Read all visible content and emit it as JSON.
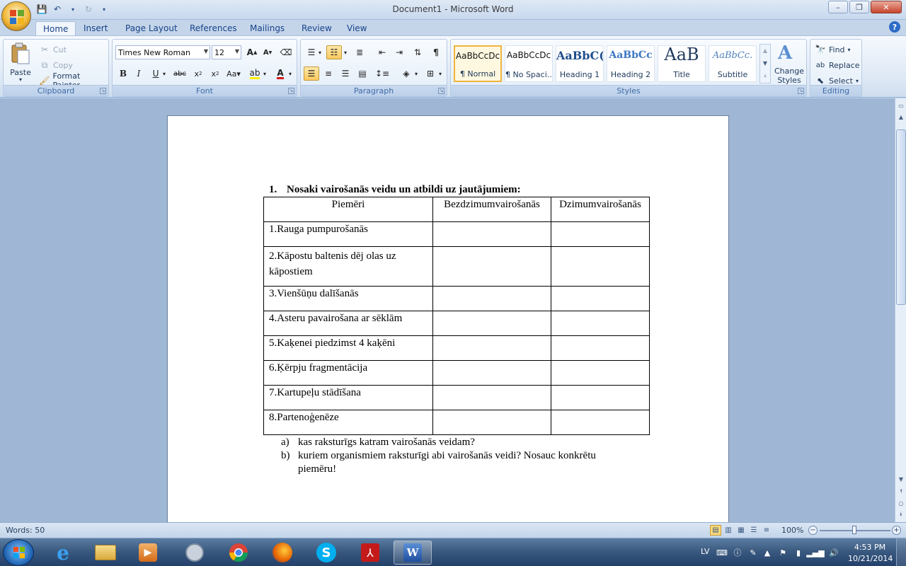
{
  "app": {
    "title": "Document1 - Microsoft Word"
  },
  "tabs": [
    "Home",
    "Insert",
    "Page Layout",
    "References",
    "Mailings",
    "Review",
    "View"
  ],
  "clipboard": {
    "paste": "Paste",
    "cut": "Cut",
    "copy": "Copy",
    "format_painter": "Format Painter",
    "label": "Clipboard"
  },
  "font": {
    "family": "Times New Roman",
    "size": "12",
    "label": "Font"
  },
  "paragraph": {
    "label": "Paragraph"
  },
  "styles": {
    "items": [
      {
        "sample": "AaBbCcDc",
        "name": "¶ Normal"
      },
      {
        "sample": "AaBbCcDc",
        "name": "¶ No Spaci..."
      },
      {
        "sample": "AaBbC(",
        "name": "Heading 1"
      },
      {
        "sample": "AaBbCc",
        "name": "Heading 2"
      },
      {
        "sample": "AaB",
        "name": "Title"
      },
      {
        "sample": "AaBbCc.",
        "name": "Subtitle"
      }
    ],
    "change_styles": "Change Styles",
    "label": "Styles"
  },
  "editing": {
    "find": "Find",
    "replace": "Replace",
    "select": "Select",
    "label": "Editing"
  },
  "document": {
    "heading_num": "1.",
    "heading": "Nosaki vairošanās veidu un atbildi uz jautājumiem:",
    "table_headers": [
      "Piemēri",
      "Bezdzimumvairošanās",
      "Dzimumvairošanās"
    ],
    "rows": [
      "1.Rauga pumpurošanās",
      "2.Kāpostu baltenis dēj olas uz kāpostiem",
      "3.Vienšūņu dalīšanās",
      "4.Asteru pavairošana ar sēklām",
      "5.Kaķenei piedzimst 4 kaķēni",
      "6.Ķērpju fragmentācija",
      "7.Kartupeļu stādīšana",
      "8.Partenoģenēze"
    ],
    "questions": [
      {
        "marker": "a)",
        "text": "kas raksturīgs katram vairošanās veidam?"
      },
      {
        "marker": "b)",
        "text": "kuriem organismiem raksturīgi abi vairošanās veidi? Nosauc konkrētu"
      },
      {
        "marker": "",
        "text": "piemēru!"
      }
    ]
  },
  "status": {
    "words": "Words: 50",
    "zoom": "100%"
  },
  "tray": {
    "lang": "LV",
    "time": "4:53 PM",
    "date": "10/21/2014"
  }
}
